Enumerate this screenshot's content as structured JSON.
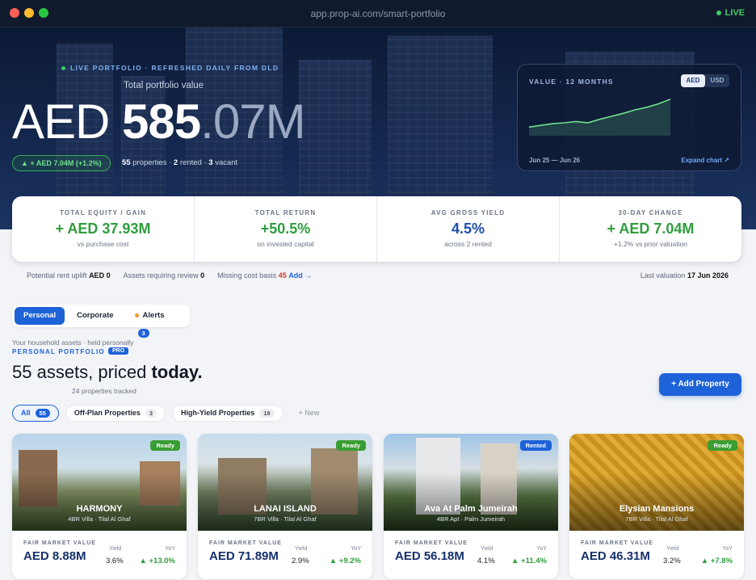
{
  "browser": {
    "url": "app.prop-ai.com/smart-portfolio",
    "status": "LIVE"
  },
  "hero": {
    "live_label": "LIVE PORTFOLIO · REFRESHED DAILY FROM DLD",
    "subtitle": "Total portfolio value",
    "currency": "AED",
    "value_int": "585",
    "value_dec": ".07M",
    "change_chip": "▲ + AED 7.04M (+1.2%)",
    "properties_count": "55",
    "properties_label": "properties ·",
    "rented_count": "2",
    "rented_label": "rented ·",
    "vacant_count": "3",
    "vacant_label": "vacant"
  },
  "value_card": {
    "title": "VALUE · 12 MONTHS",
    "toggle": [
      "AED",
      "USD"
    ],
    "active_currency": "AED",
    "range": "Jun 25 — Jun 26",
    "expand": "Expand chart ↗",
    "accent": "#6fe08e"
  },
  "kpis": [
    {
      "label": "TOTAL EQUITY / GAIN",
      "value": "+ AED 37.93M",
      "sub": "vs purchase cost",
      "tone": "green"
    },
    {
      "label": "TOTAL RETURN",
      "value": "+50.5%",
      "sub": "on invested capital",
      "tone": "green"
    },
    {
      "label": "AVG GROSS YIELD",
      "value": "4.5%",
      "sub": "across 2 rented",
      "tone": "blue"
    },
    {
      "label": "30-DAY CHANGE",
      "value": "+ AED 7.04M",
      "sub": "+1.2% vs prior valuation",
      "tone": "green"
    }
  ],
  "meta": {
    "rent_uplift_label": "Potential rent uplift",
    "rent_uplift_value": "AED 0",
    "review_label": "Assets requiring review",
    "review_value": "0",
    "missing_label": "Missing cost basis",
    "missing_value": "45",
    "missing_action": "Add →",
    "last_valuation_label": "Last valuation",
    "last_valuation_value": "17 Jun 2026"
  },
  "tabs": {
    "personal": "Personal",
    "corporate": "Corporate",
    "alerts": "Alerts",
    "alerts_count": "3"
  },
  "portfolio": {
    "household": "Your household assets · held personally",
    "title": "PERSONAL PORTFOLIO",
    "badge": "PRO",
    "heading_a": "55 assets, priced ",
    "heading_b": "today.",
    "tracked": "24 properties tracked",
    "add_button": "+ Add Property"
  },
  "filters": [
    {
      "label": "All",
      "count": "55"
    },
    {
      "label": "Off-Plan Properties",
      "count": "3"
    },
    {
      "label": "High-Yield Properties",
      "count": "18"
    }
  ],
  "filter_new": "+ New",
  "properties": [
    {
      "name": "HARMONY",
      "type": "4BR Villa · Tilal Al Ghaf",
      "status": "Ready",
      "fmv_label": "FAIR MARKET VALUE",
      "fmv": "AED 8.88M",
      "yield_label": "Yield",
      "yield": "3.6%",
      "yoy_label": "YoY",
      "yoy": "▲ +13.0%"
    },
    {
      "name": "LANAI ISLAND",
      "type": "7BR Villa · Tilal Al Ghaf",
      "status": "Ready",
      "fmv_label": "FAIR MARKET VALUE",
      "fmv": "AED 71.89M",
      "yield_label": "Yield",
      "yield": "2.9%",
      "yoy_label": "YoY",
      "yoy": "▲ +9.2%"
    },
    {
      "name": "Ava At Palm Jumeirah",
      "type": "4BR Apt · Palm Jumeirah",
      "status": "Rented",
      "fmv_label": "FAIR MARKET VALUE",
      "fmv": "AED 56.18M",
      "yield_label": "Yield",
      "yield": "4.1%",
      "yoy_label": "YoY",
      "yoy": "▲ +11.4%"
    },
    {
      "name": "Elysian Mansions",
      "type": "7BR Villa · Tilal Al Ghaf",
      "status": "Ready",
      "fmv_label": "FAIR MARKET VALUE",
      "fmv": "AED 46.31M",
      "yield_label": "Yield",
      "yield": "3.2%",
      "yoy_label": "YoY",
      "yoy": "▲ +7.8%"
    }
  ],
  "chart_data": {
    "type": "area",
    "x": [
      "Jun 25",
      "",
      "",
      "",
      "",
      "",
      "",
      "",
      "",
      "",
      "",
      "",
      "Jun 26"
    ],
    "values": [
      520,
      524,
      528,
      530,
      533,
      530,
      538,
      545,
      552,
      560,
      566,
      574,
      585
    ],
    "ylim": [
      500,
      590
    ]
  }
}
